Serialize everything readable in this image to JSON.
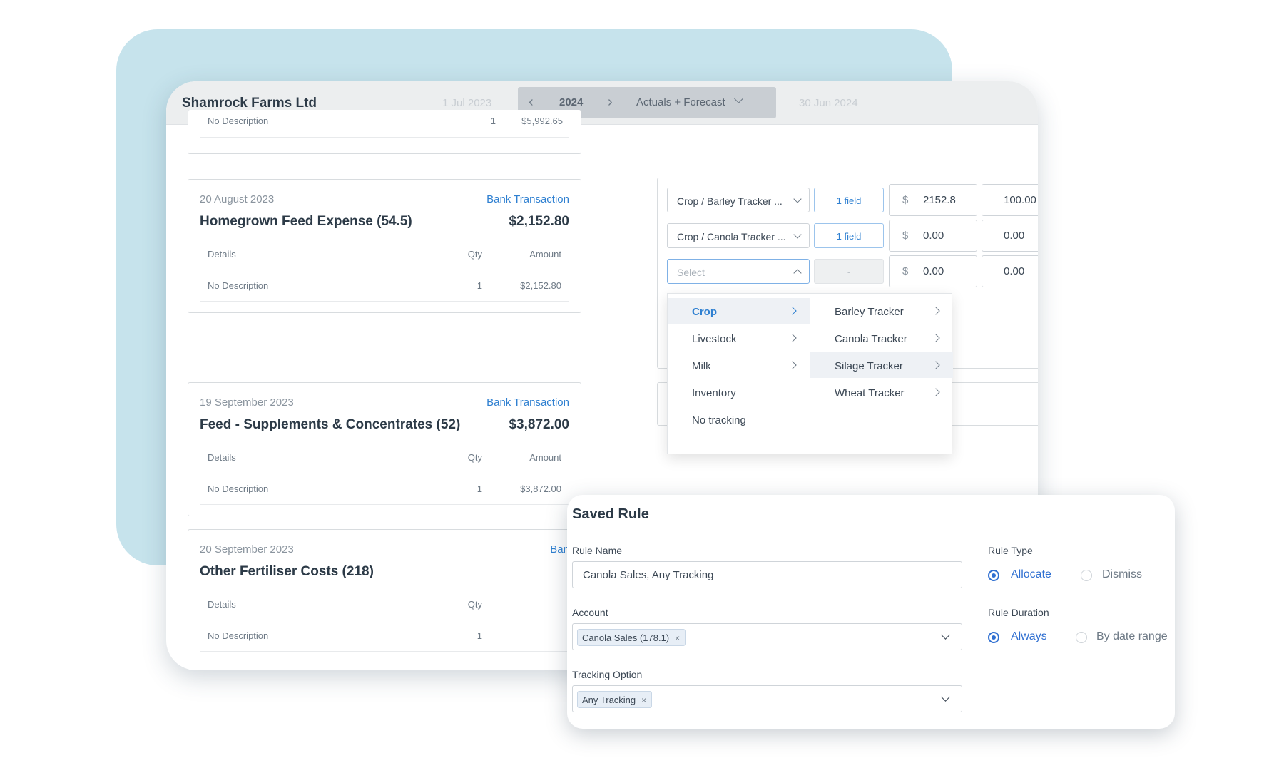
{
  "header": {
    "company": "Shamrock Farms Ltd",
    "date_start": "1 Jul 2023",
    "year": "2024",
    "mode": "Actuals + Forecast",
    "date_end": "30 Jun 2024"
  },
  "top_partial": {
    "detail": "No Description",
    "qty": "1",
    "amount": "$5,992.65"
  },
  "transactions": [
    {
      "date": "20 August 2023",
      "type": "Bank Transaction",
      "title": "Homegrown Feed Expense (54.5)",
      "amount": "$2,152.80",
      "col_details": "Details",
      "col_qty": "Qty",
      "col_amount": "Amount",
      "detail": "No Description",
      "qty": "1",
      "line_amount": "$2,152.80"
    },
    {
      "date": "19 September 2023",
      "type": "Bank Transaction",
      "title": "Feed - Supplements & Concentrates (52)",
      "amount": "$3,872.00",
      "col_details": "Details",
      "col_qty": "Qty",
      "col_amount": "Amount",
      "detail": "No Description",
      "qty": "1",
      "line_amount": "$3,872.00"
    },
    {
      "date": "20 September 2023",
      "type": "Ban",
      "title": "Other Fertiliser Costs (218)",
      "col_details": "Details",
      "col_qty": "Qty",
      "detail": "No Description",
      "qty": "1"
    }
  ],
  "allocations": [
    {
      "tracking": "Crop / Barley Tracker ...",
      "field_btn": "1 field",
      "currency": "$",
      "amount": "2152.8",
      "percent": "100.00"
    },
    {
      "tracking": "Crop / Canola Tracker ...",
      "field_btn": "1 field",
      "currency": "$",
      "amount": "0.00",
      "percent": "0.00"
    },
    {
      "tracking": "Select",
      "field_btn": "-",
      "currency": "$",
      "amount": "0.00",
      "percent": "0.00"
    }
  ],
  "dropdown": {
    "categories": [
      "Crop",
      "Livestock",
      "Milk",
      "Inventory",
      "No tracking"
    ],
    "active_category": "Crop",
    "options": [
      "Barley Tracker",
      "Canola Tracker",
      "Silage Tracker",
      "Wheat Tracker"
    ],
    "hovered_option": "Silage Tracker"
  },
  "saved_rule": {
    "title": "Saved Rule",
    "rule_name_label": "Rule Name",
    "rule_name_value": "Canola Sales, Any Tracking",
    "account_label": "Account",
    "account_tag": "Canola Sales (178.1)",
    "tracking_label": "Tracking Option",
    "tracking_tag": "Any Tracking",
    "tag_remove": "×",
    "rule_type_label": "Rule Type",
    "rule_type_options": [
      "Allocate",
      "Dismiss"
    ],
    "rule_type_selected": "Allocate",
    "rule_duration_label": "Rule Duration",
    "rule_duration_options": [
      "Always",
      "By date range"
    ],
    "rule_duration_selected": "Always"
  },
  "colors": {
    "accent": "#2f80d1",
    "background_shape": "#c6e3ec",
    "radio_selected": "#2f6fd1"
  }
}
